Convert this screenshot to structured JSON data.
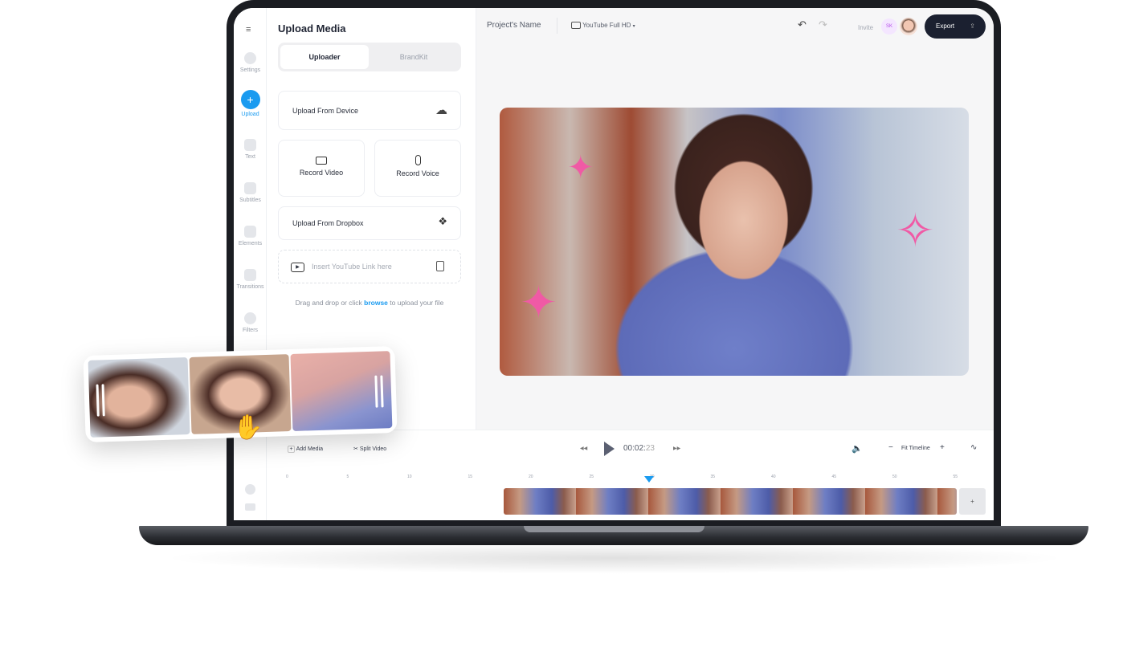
{
  "sidebar": {
    "menu_icon": "hamburger-icon",
    "items": [
      {
        "label": "Settings",
        "icon": "hexagon-icon"
      },
      {
        "label": "Upload",
        "icon": "plus-icon",
        "active": true
      },
      {
        "label": "Text",
        "icon": "text-icon"
      },
      {
        "label": "Subtitles",
        "icon": "subtitles-icon"
      },
      {
        "label": "Elements",
        "icon": "elements-icon"
      },
      {
        "label": "Transitions",
        "icon": "transitions-icon"
      },
      {
        "label": "Filters",
        "icon": "filters-icon"
      }
    ]
  },
  "panel": {
    "title": "Upload Media",
    "tabs": [
      {
        "label": "Uploader",
        "active": true
      },
      {
        "label": "BrandKit"
      }
    ],
    "upload_device": "Upload From Device",
    "record_video": "Record Video",
    "record_voice": "Record Voice",
    "upload_dropbox": "Upload From Dropbox",
    "youtube_placeholder": "Insert YouTube Link here",
    "drag_text_1": "Drag and drop or click ",
    "browse": "browse",
    "drag_text_2": " to upload your file"
  },
  "header": {
    "project_name": "Project's Name",
    "format": "YouTube Full HD",
    "invite": "Invite",
    "avatar_initials": "SK",
    "export": "Export"
  },
  "toolbar": {
    "add_media": "Add Media",
    "split_video": "Split Video",
    "time_main": "00:02:",
    "time_frames": "23",
    "fit_timeline": "Fit Timeline",
    "add_track": "+"
  },
  "timeline": {
    "ticks": [
      "0",
      "5",
      "10",
      "15",
      "20",
      "25",
      "30",
      "35",
      "40",
      "45",
      "50",
      "55",
      "60"
    ],
    "playhead": "30"
  },
  "colors": {
    "accent": "#1a9bf0",
    "dark": "#1b2030",
    "sticker": "#f05aa5"
  }
}
